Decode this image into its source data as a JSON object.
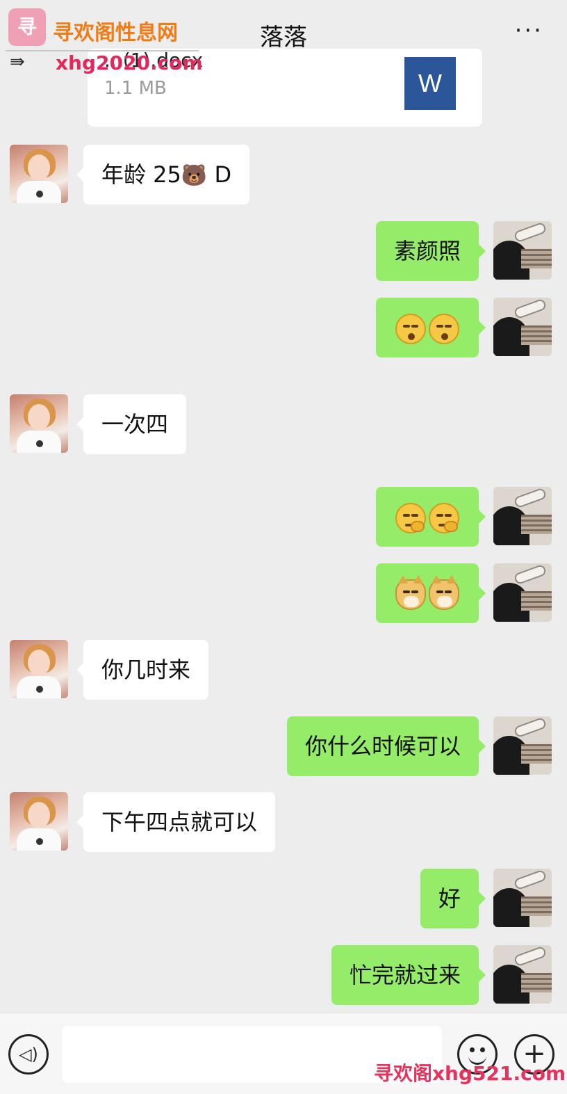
{
  "header": {
    "title": "落落",
    "more_label": "···"
  },
  "watermark": {
    "logo_text": "寻",
    "site_name": "寻欢阁性息网",
    "url_top": "xhg2020.com",
    "bottom_text": "寻欢阁xhg521.com"
  },
  "file_message": {
    "file_name": "...(1).docx",
    "file_size": "1.1 MB",
    "icon_letter": "W"
  },
  "messages": [
    {
      "sender": "her",
      "text_before": "年龄 25",
      "emoji": "bear",
      "text_after": " D"
    },
    {
      "sender": "me",
      "text": "素颜照"
    },
    {
      "sender": "me",
      "emoji_pair": "kiss-face-emoji"
    },
    {
      "sender": "her",
      "text": "一次四"
    },
    {
      "sender": "me",
      "emoji_pair": "smirk-face-emoji"
    },
    {
      "sender": "me",
      "emoji_pair": "doge-emoji"
    },
    {
      "sender": "her",
      "text": "你几时来"
    },
    {
      "sender": "me",
      "text": "你什么时候可以"
    },
    {
      "sender": "her",
      "text": "下午四点就可以"
    },
    {
      "sender": "me",
      "text": "好"
    },
    {
      "sender": "me",
      "text": "忙完就过来"
    }
  ],
  "input_bar": {
    "message_input_value": "",
    "plus_label": "+",
    "voice_label": "◁)"
  },
  "colors": {
    "background": "#ededed",
    "sent_bubble": "#95ec69",
    "received_bubble": "#ffffff",
    "word_icon": "#2b579a"
  }
}
